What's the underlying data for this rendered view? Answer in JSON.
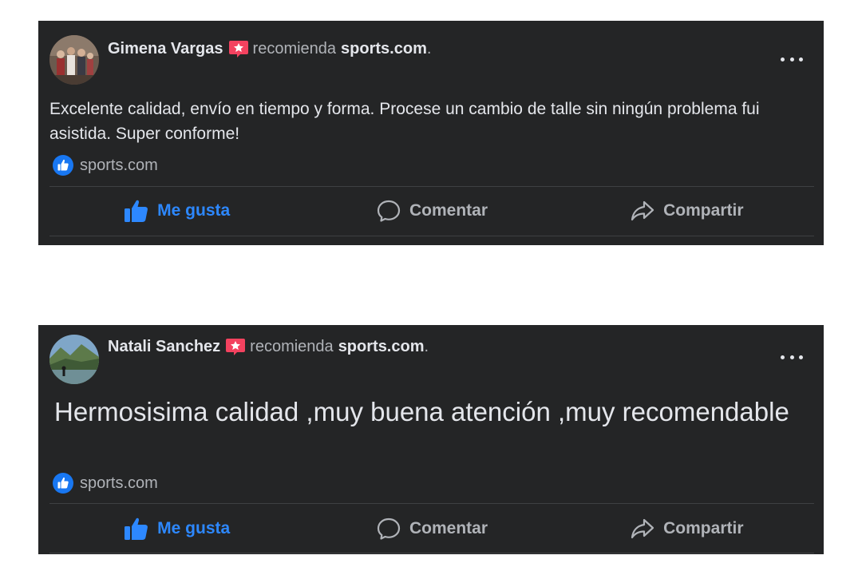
{
  "posts": [
    {
      "author": "Gimena Vargas",
      "recommends_text": "recomienda",
      "page": "sports.com",
      "period": ".",
      "body": "Excelente calidad, envío en tiempo y forma. Procese un cambio de talle sin ningún problema fui asistida. Super conforme!",
      "page_link": "sports.com",
      "actions": {
        "like": "Me gusta",
        "comment": "Comentar",
        "share": "Compartir"
      }
    },
    {
      "author": "Natali Sanchez",
      "recommends_text": "recomienda",
      "page": "sports.com",
      "period": ".",
      "body": "Hermosisima calidad ,muy buena atención ,muy recomendable",
      "page_link": "sports.com",
      "actions": {
        "like": "Me gusta",
        "comment": "Comentar",
        "share": "Compartir"
      }
    }
  ],
  "colors": {
    "card_bg": "#242526",
    "primary_text": "#e4e6eb",
    "secondary_text": "#b0b3b8",
    "like_blue": "#2d88ff",
    "recommend_red": "#f3425f"
  }
}
